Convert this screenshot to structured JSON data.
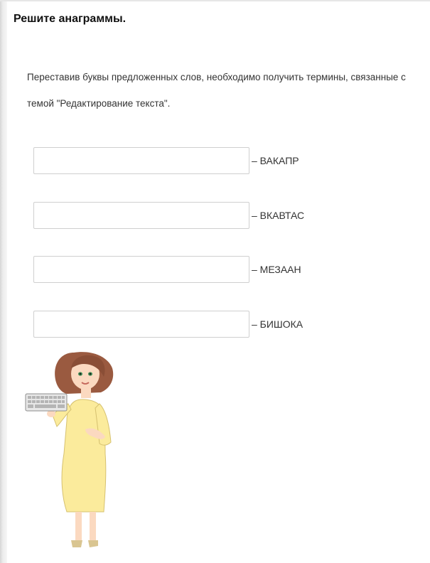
{
  "title": "Решите анаграммы.",
  "instructions": {
    "line1": "Переставив буквы предложенных слов, необходимо получить термины, связанные с",
    "line2": "темой \"Редактирование текста\"."
  },
  "anagrams": [
    {
      "value": "",
      "word": "– ВАКАПР"
    },
    {
      "value": "",
      "word": "– ВКАВТАС"
    },
    {
      "value": "",
      "word": "– МЕЗААН"
    },
    {
      "value": "",
      "word": "– БИШОКА"
    }
  ],
  "illustration": {
    "icon": "woman-with-keyboard-illustration",
    "colors": {
      "dress": "#fbeb9c",
      "hair": "#9a5a40",
      "skin": "#fbd9c0",
      "keyboard": "#e8e8e8"
    }
  }
}
